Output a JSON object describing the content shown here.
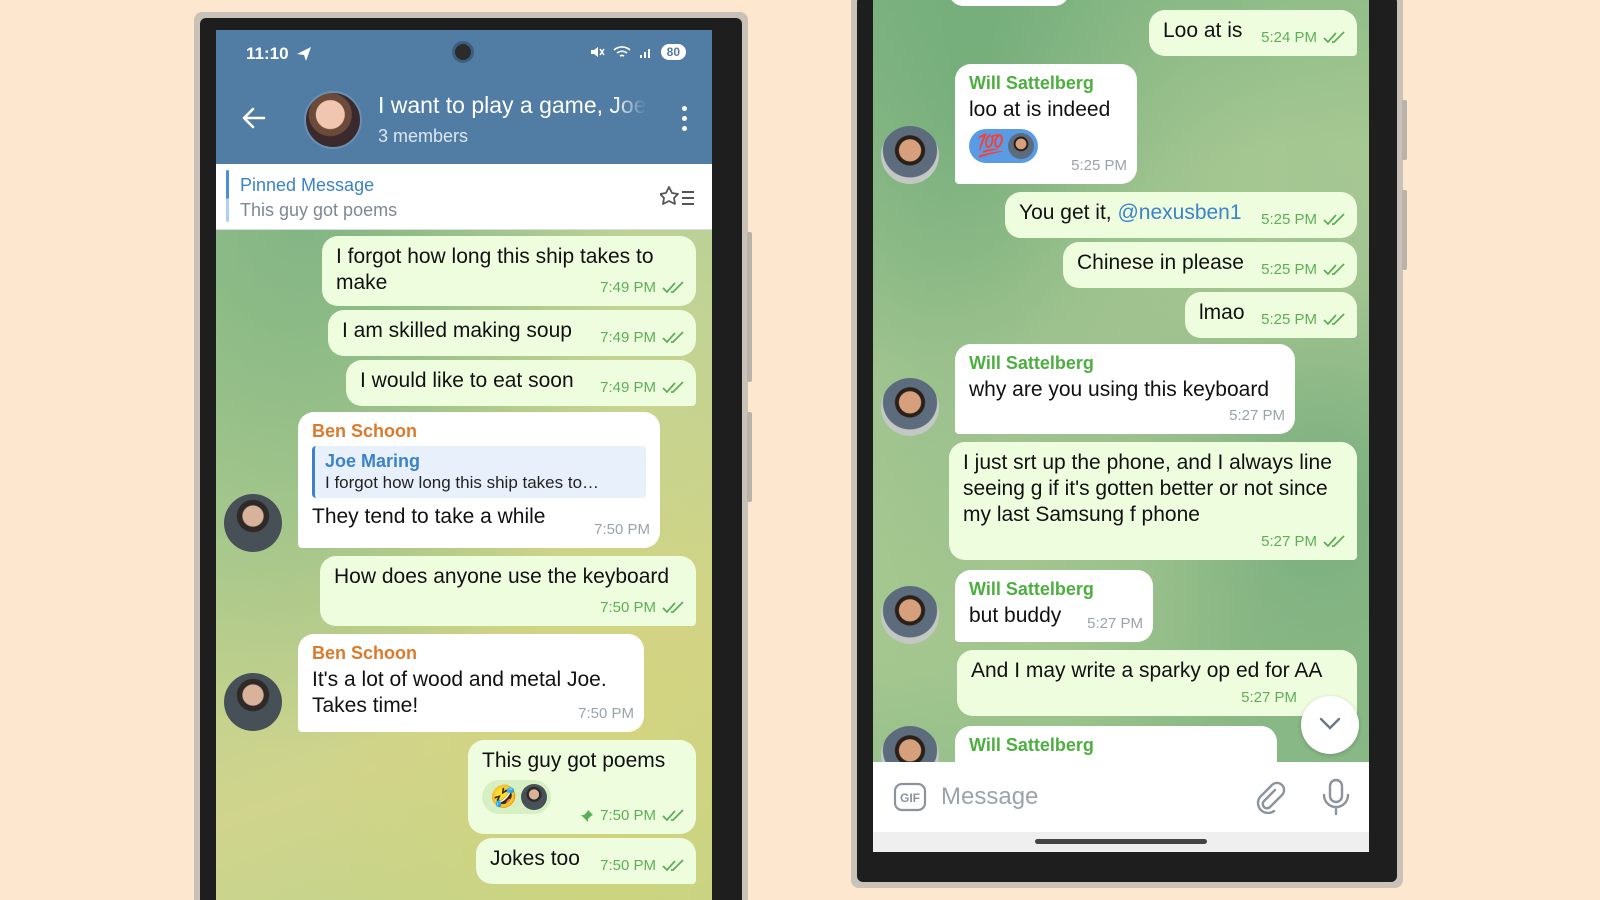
{
  "colors": {
    "background": "#fde7cf",
    "header": "#517ca3",
    "outgoing_bubble": "#effddf",
    "incoming_bubble": "#ffffff",
    "read_check": "#5eae58",
    "sender_orange": "#db7a2a",
    "sender_green": "#4caf3f",
    "link": "#3a83c9"
  },
  "left_phone": {
    "status": {
      "time": "11:10",
      "battery": "80"
    },
    "header": {
      "title": "I want to play a game, Joe",
      "subtitle": "3 members"
    },
    "pinned": {
      "title": "Pinned Message",
      "text": "This guy got poems"
    },
    "messages": [
      {
        "text": "I forgot how long this ship takes to make",
        "time": "7:49 PM"
      },
      {
        "text": "I am skilled making soup",
        "time": "7:49 PM"
      },
      {
        "text": "I would like to eat soon",
        "time": "7:49 PM"
      },
      {
        "sender": "Ben Schoon",
        "reply_name": "Joe Maring",
        "reply_text": "I forgot how long this ship takes to…",
        "text": "They tend to take a while",
        "time": "7:50 PM"
      },
      {
        "text": "How does anyone use the keyboard",
        "time": "7:50 PM"
      },
      {
        "sender": "Ben Schoon",
        "text": "It's a lot of wood and metal Joe. Takes time!",
        "time": "7:50 PM"
      },
      {
        "text": "This guy got poems",
        "reaction": "🤣",
        "time": "7:50 PM"
      },
      {
        "text": "Jokes too",
        "time": "7:50 PM"
      }
    ]
  },
  "right_phone": {
    "messages": [
      {
        "text": "Loo at is",
        "time": "5:24 PM"
      },
      {
        "sender": "Will Sattelberg",
        "text": "loo at is indeed",
        "reaction": "💯",
        "time": "5:25 PM"
      },
      {
        "text_before": "You get it, ",
        "mention": "@nexusben1",
        "time": "5:25 PM"
      },
      {
        "text": "Chinese in please",
        "time": "5:25 PM"
      },
      {
        "text": "lmao",
        "time": "5:25 PM"
      },
      {
        "sender": "Will Sattelberg",
        "text": "why are you using this keyboard",
        "time": "5:27 PM"
      },
      {
        "text": "I just srt up the phone, and I always line seeing g if it's gotten better or not since my last Samsung f phone",
        "time": "5:27 PM"
      },
      {
        "sender": "Will Sattelberg",
        "text": "but buddy",
        "time": "5:27 PM"
      },
      {
        "text": "And I may write a sparky op ed for AA",
        "time": "5:27 PM"
      },
      {
        "sender": "Will Sattelberg"
      }
    ],
    "input": {
      "placeholder": "Message"
    },
    "icons": {
      "gif": "gif-icon",
      "attach": "paperclip-icon",
      "mic": "microphone-icon",
      "scroll": "chevron-down-icon"
    }
  }
}
